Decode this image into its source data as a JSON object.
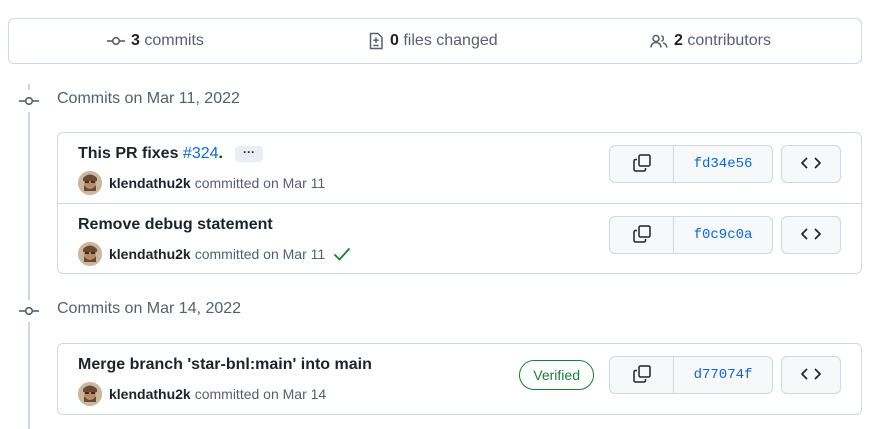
{
  "summary": {
    "commits": {
      "count": "3",
      "label": "commits",
      "icon": "git-commit-icon"
    },
    "files": {
      "count": "0",
      "label": "files changed",
      "icon": "file-diff-icon"
    },
    "contributors": {
      "count": "2",
      "label": "contributors",
      "icon": "people-icon"
    }
  },
  "groups": [
    {
      "title": "Commits on Mar 11, 2022",
      "commits": [
        {
          "title_prefix": "This PR fixes ",
          "issue_link": "#324",
          "title_suffix": ".",
          "ellipsis": "···",
          "author": "klendathu2k",
          "committed_text": "committed on Mar 11",
          "sha": "fd34e56",
          "verified": false,
          "check": false
        },
        {
          "title": "Remove debug statement",
          "author": "klendathu2k",
          "committed_text": "committed on Mar 11",
          "sha": "f0c9c0a",
          "verified": false,
          "check": true
        }
      ]
    },
    {
      "title": "Commits on Mar 14, 2022",
      "commits": [
        {
          "title": "Merge branch 'star-bnl:main' into main",
          "author": "klendathu2k",
          "committed_text": "committed on Mar 14",
          "sha": "d77074f",
          "verified": true,
          "verified_label": "Verified",
          "check": false
        }
      ]
    }
  ],
  "colors": {
    "link": "#0969da",
    "success": "#1a7f37",
    "border": "#d0d7de",
    "muted": "#57606a"
  }
}
